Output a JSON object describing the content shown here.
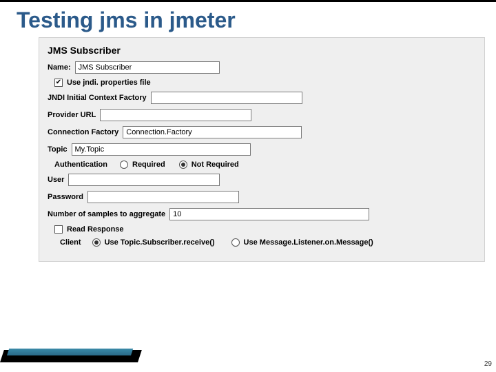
{
  "slide": {
    "title": "Testing jms in jmeter",
    "page_number": "29"
  },
  "panel": {
    "heading": "JMS Subscriber"
  },
  "fields": {
    "name_label": "Name:",
    "name_value": "JMS Subscriber",
    "use_jndi_label": "Use jndi. properties file",
    "use_jndi_checked": "✔",
    "jndi_ctx_label": "JNDI Initial Context Factory",
    "jndi_ctx_value": "",
    "provider_url_label": "Provider URL",
    "provider_url_value": "",
    "connection_factory_label": "Connection Factory",
    "connection_factory_value": "Connection.Factory",
    "topic_label": "Topic",
    "topic_value": "My.Topic",
    "auth_label": "Authentication",
    "auth_required": "Required",
    "auth_not_required": "Not Required",
    "user_label": "User",
    "user_value": "",
    "password_label": "Password",
    "password_value": "",
    "samples_label": "Number of samples to aggregate",
    "samples_value": "10",
    "read_response_label": "Read Response",
    "client_label": "Client",
    "client_receive": "Use Topic.Subscriber.receive()",
    "client_listener": "Use Message.Listener.on.Message()"
  }
}
